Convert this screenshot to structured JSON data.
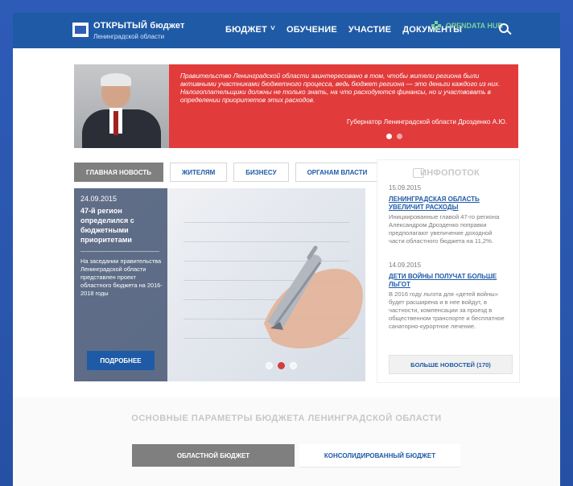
{
  "header": {
    "logo_title": "ОТКРЫТЫЙ бюджет",
    "logo_subtitle": "Ленинградской области",
    "nav": [
      "БЮДЖЕТ",
      "ОБУЧЕНИЕ",
      "УЧАСТИЕ",
      "ДОКУМЕНТЫ"
    ],
    "opendata": "OPENDATA HUB"
  },
  "banner": {
    "quote": "Правительство Ленинградской области заинтересовано в том, чтобы жители региона были активными участниками бюджетного процесса, ведь бюджет региона — это деньги каждого из них. Налогоплательщики должны не только знать, на что расходуются финансы, но и участвовать в определении приоритетов этих расходов.",
    "author": "Губернатор Ленинградской области Дрозденко А.Ю."
  },
  "tabs": [
    "ГЛАВНАЯ НОВОСТЬ",
    "ЖИТЕЛЯМ",
    "БИЗНЕСУ",
    "ОРГАНАМ ВЛАСТИ"
  ],
  "news": {
    "date": "24.09.2015",
    "headline": "47-й регион определился с бюджетными приоритетами",
    "text": "На заседании правительства Ленинградской области представлен проект областного бюджета на 2016-2018 годы",
    "more": "ПОДРОБНЕЕ"
  },
  "infostream": {
    "title": "ИНФОПОТОК",
    "items": [
      {
        "date": "15.09.2015",
        "title": "ЛЕНИНГРАДСКАЯ ОБЛАСТЬ УВЕЛИЧИТ РАСХОДЫ",
        "text": "Инициированные главой 47-го региона Александром Дрозденко поправки предполагают увеличение доходной части областного бюджета на 11,2%."
      },
      {
        "date": "14.09.2015",
        "title": "ДЕТИ ВОЙНЫ ПОЛУЧАТ БОЛЬШЕ ЛЬГОТ",
        "text": "В 2016 году льгота для «детей войны» будет расширена и в нее войдут, в частности, компенсации за проезд в общественном транспорте и бесплатное санаторно-курортное лечение."
      }
    ],
    "more": "БОЛЬШЕ НОВОСТЕЙ (170)"
  },
  "params": {
    "title": "ОСНОВНЫЕ ПАРАМЕТРЫ БЮДЖЕТА ЛЕНИНГРАДСКОЙ ОБЛАСТИ",
    "buttons": [
      "ОБЛАСТНОЙ БЮДЖЕТ",
      "КОНСОЛИДИРОВАННЫЙ БЮДЖЕТ"
    ]
  },
  "colors": {
    "brand_blue": "#1f5aa6",
    "accent_red": "#e23b3b",
    "opendata_green": "#7ad19a"
  }
}
